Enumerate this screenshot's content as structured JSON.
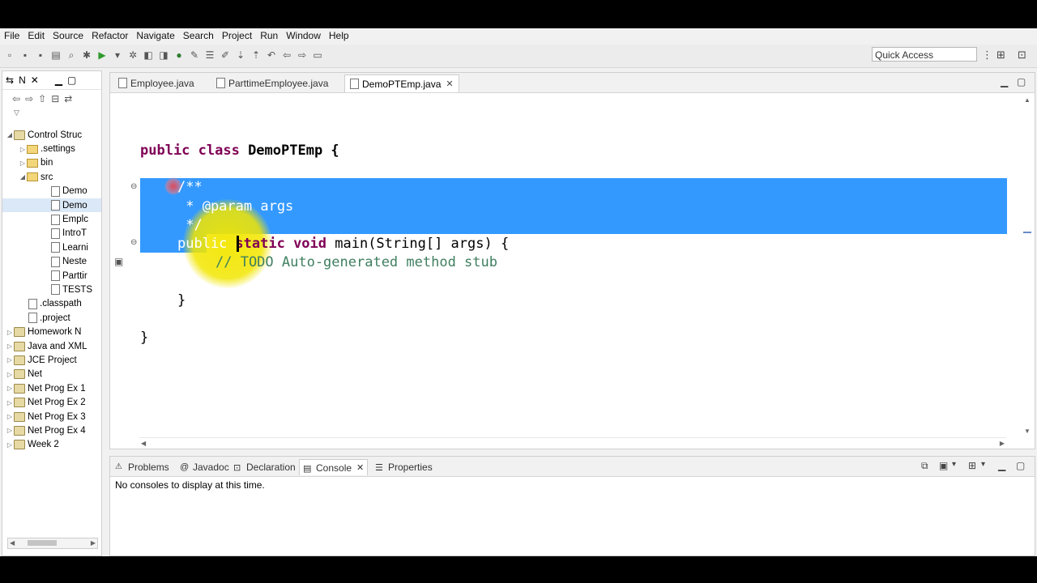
{
  "menu": [
    "File",
    "Edit",
    "Source",
    "Refactor",
    "Navigate",
    "Search",
    "Project",
    "Run",
    "Window",
    "Help"
  ],
  "toolbar": {
    "quick_access": "Quick Access"
  },
  "navigator": {
    "tab_label": "N",
    "items": [
      {
        "label": "Control Struc",
        "level": 0,
        "type": "project",
        "expanded": true
      },
      {
        "label": ".settings",
        "level": 1,
        "type": "folder",
        "expanded": false
      },
      {
        "label": "bin",
        "level": 1,
        "type": "folder",
        "expanded": false
      },
      {
        "label": "src",
        "level": 1,
        "type": "folder",
        "expanded": true
      },
      {
        "label": "Demo",
        "level": 2,
        "type": "file"
      },
      {
        "label": "Demo",
        "level": 2,
        "type": "file",
        "selected": true
      },
      {
        "label": "Emplc",
        "level": 2,
        "type": "file"
      },
      {
        "label": "IntroT",
        "level": 2,
        "type": "file"
      },
      {
        "label": "Learni",
        "level": 2,
        "type": "file"
      },
      {
        "label": "Neste",
        "level": 2,
        "type": "file"
      },
      {
        "label": "Parttir",
        "level": 2,
        "type": "file"
      },
      {
        "label": "TESTS",
        "level": 2,
        "type": "file"
      },
      {
        "label": ".classpath",
        "level": 1,
        "type": "file"
      },
      {
        "label": ".project",
        "level": 1,
        "type": "file"
      },
      {
        "label": "Homework N",
        "level": 0,
        "type": "project",
        "expanded": false
      },
      {
        "label": "Java and XML",
        "level": 0,
        "type": "project",
        "expanded": false
      },
      {
        "label": "JCE Project",
        "level": 0,
        "type": "project",
        "expanded": false
      },
      {
        "label": "Net",
        "level": 0,
        "type": "project",
        "expanded": false
      },
      {
        "label": "Net Prog Ex 1",
        "level": 0,
        "type": "project",
        "expanded": false
      },
      {
        "label": "Net Prog Ex 2",
        "level": 0,
        "type": "project",
        "expanded": false
      },
      {
        "label": "Net Prog Ex 3",
        "level": 0,
        "type": "project",
        "expanded": false
      },
      {
        "label": "Net Prog Ex 4",
        "level": 0,
        "type": "project",
        "expanded": false
      },
      {
        "label": "Week 2",
        "level": 0,
        "type": "project",
        "expanded": false
      }
    ]
  },
  "editor": {
    "tabs": [
      "Employee.java",
      "ParttimeEmployee.java",
      "DemoPTEmp.java"
    ],
    "active_tab": 2,
    "lines": {
      "l1_kw": "public class ",
      "l1_name": "DemoPTEmp {",
      "l2": "/**",
      "l3": " * @param args",
      "l4": " */",
      "l5_kw1": "public",
      "l5_kw2": "static void",
      "l5_rest": " main(String[] args) {",
      "l6": "// TODO Auto-generated method stub",
      "l7": "}",
      "l8": "}"
    }
  },
  "bottom_panel": {
    "tabs": [
      "Problems",
      "Javadoc",
      "Declaration",
      "Console",
      "Properties"
    ],
    "active_tab": "Console",
    "message": "No consoles to display at this time."
  },
  "colors": {
    "selection": "#3399ff",
    "keyword": "#7f0055",
    "comment": "#3f7f5f",
    "cursor_highlight": "#f2e600"
  }
}
